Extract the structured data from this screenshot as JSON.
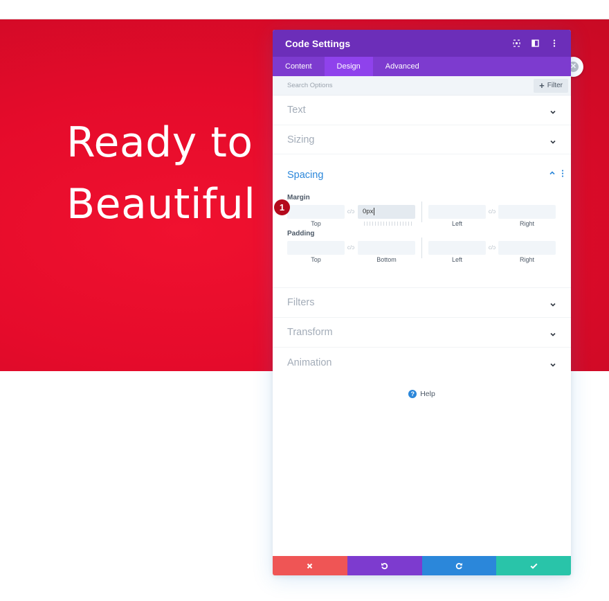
{
  "hero": {
    "line1": "Ready to",
    "line2": "Beautiful"
  },
  "modal": {
    "title": "Code Settings",
    "tabs": [
      {
        "label": "Content",
        "active": false
      },
      {
        "label": "Design",
        "active": true
      },
      {
        "label": "Advanced",
        "active": false
      }
    ],
    "search": {
      "placeholder": "Search Options"
    },
    "filter_label": "Filter",
    "sections": {
      "text": "Text",
      "sizing": "Sizing",
      "spacing": "Spacing",
      "filters": "Filters",
      "transform": "Transform",
      "animation": "Animation"
    },
    "spacing": {
      "margin_label": "Margin",
      "margin": {
        "top": {
          "value": "",
          "caption": "Top"
        },
        "bottom": {
          "value": "0px",
          "caption": ""
        },
        "left": {
          "value": "",
          "caption": "Left"
        },
        "right": {
          "value": "",
          "caption": "Right"
        }
      },
      "padding_label": "Padding",
      "padding": {
        "top": {
          "value": "",
          "caption": "Top"
        },
        "bottom": {
          "value": "",
          "caption": "Bottom"
        },
        "left": {
          "value": "",
          "caption": "Left"
        },
        "right": {
          "value": "",
          "caption": "Right"
        }
      }
    },
    "help_label": "Help",
    "step_badge": "1"
  },
  "colors": {
    "hero_red": "#e50b2b",
    "header_purple": "#6c2eb9",
    "tabs_purple": "#7d3bcf",
    "active_tab": "#8f42ec",
    "accent_blue": "#2b87da",
    "cancel_red": "#ef5555",
    "save_teal": "#29c4a9"
  },
  "icons": {
    "header": [
      "target-icon",
      "columns-icon",
      "kebab-menu-icon"
    ],
    "footer": [
      "close-icon",
      "undo-icon",
      "redo-icon",
      "check-icon"
    ]
  }
}
